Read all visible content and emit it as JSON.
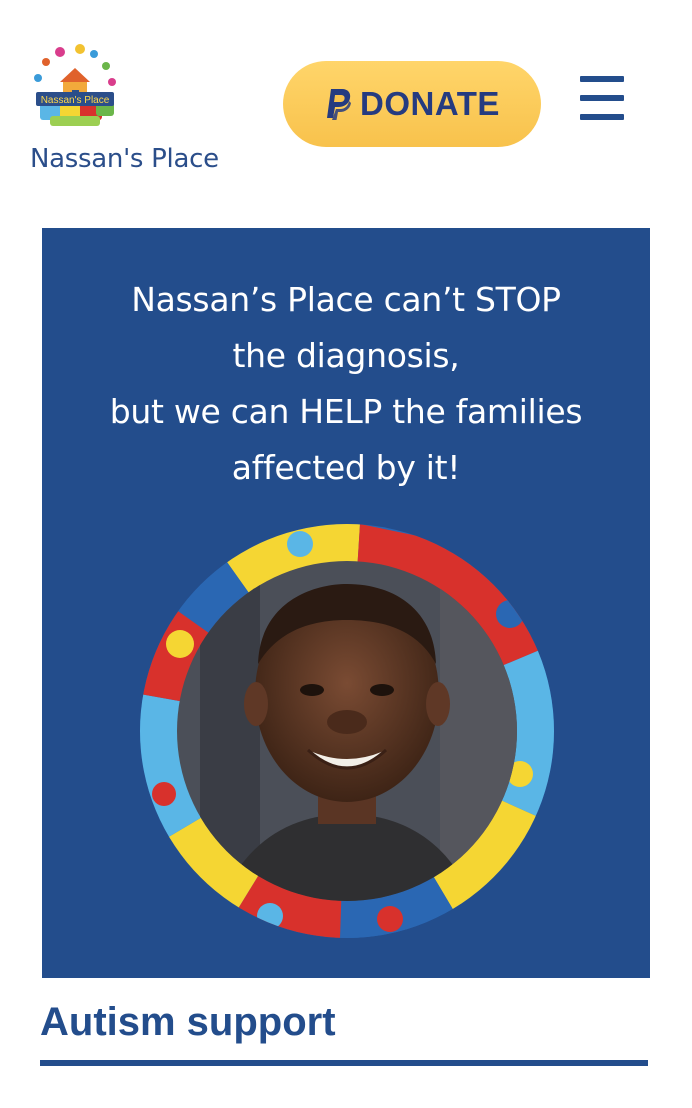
{
  "header": {
    "logo_text": "Nassan's Place",
    "logo_badge_text": "Nassan's Place",
    "donate_label": "DONATE",
    "icons": {
      "donate": "paypal-icon",
      "menu": "hamburger-menu-icon"
    }
  },
  "hero": {
    "lines": [
      "Nassan’s Place can’t STOP",
      "the diagnosis,",
      "but we can HELP the families",
      "affected by it!"
    ]
  },
  "section": {
    "title": "Autism support"
  },
  "colors": {
    "brand_blue": "#234d8c",
    "donate_yellow": "#f8c24c",
    "puzzle_red": "#d8312c",
    "puzzle_yellow": "#f5d633",
    "puzzle_light_blue": "#5ab6e6",
    "puzzle_blue": "#2a67b3"
  }
}
